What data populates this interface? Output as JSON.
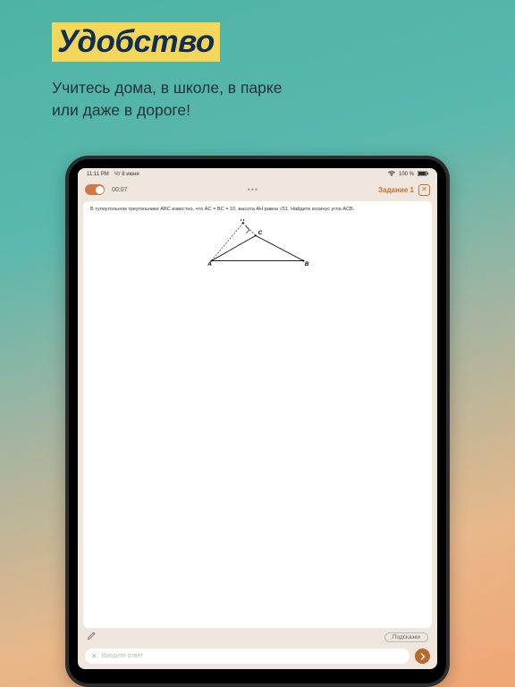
{
  "promo": {
    "headline": "Удобство",
    "subline1": "Учитесь дома, в школе, в парке",
    "subline2": "или даже в дороге!"
  },
  "status": {
    "time": "11:11 PM",
    "date": "Чт 8 июня",
    "battery": "100 %"
  },
  "app_bar": {
    "timer": "00:07",
    "task_label": "Задание 1"
  },
  "problem": {
    "text": "В тупоугольном треугольнике ABC известно, что AC = BC = 10, высота AH равна √51. Найдите косинус угла ACB.",
    "labels": {
      "A": "A",
      "B": "B",
      "C": "C",
      "H": "H"
    }
  },
  "controls": {
    "hints_label": "Подсказки",
    "answer_placeholder": "Введите ответ"
  }
}
